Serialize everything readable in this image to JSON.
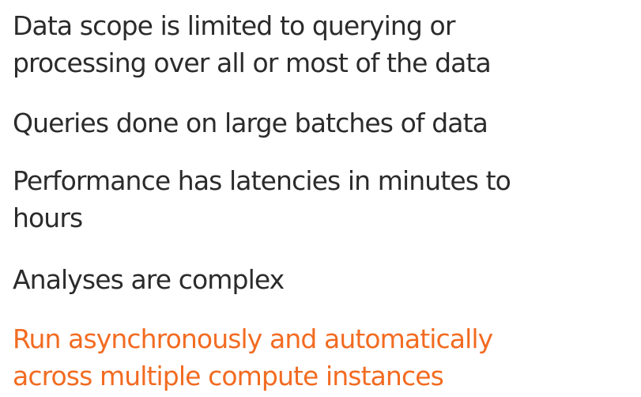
{
  "bullets": [
    {
      "lines": [
        "Data scope is limited to querying or",
        "processing over all or most of the data"
      ]
    },
    {
      "lines": [
        "Queries done on large batches of data"
      ]
    },
    {
      "lines": [
        "Performance has latencies in minutes to",
        "hours"
      ]
    },
    {
      "lines": [
        "Analyses are complex"
      ]
    },
    {
      "lines": [
        "Run asynchronously and automatically",
        "across multiple compute instances"
      ]
    }
  ],
  "colors": {
    "text": "#2b2b2b",
    "highlight": "#f26b21",
    "background": "#ffffff"
  }
}
